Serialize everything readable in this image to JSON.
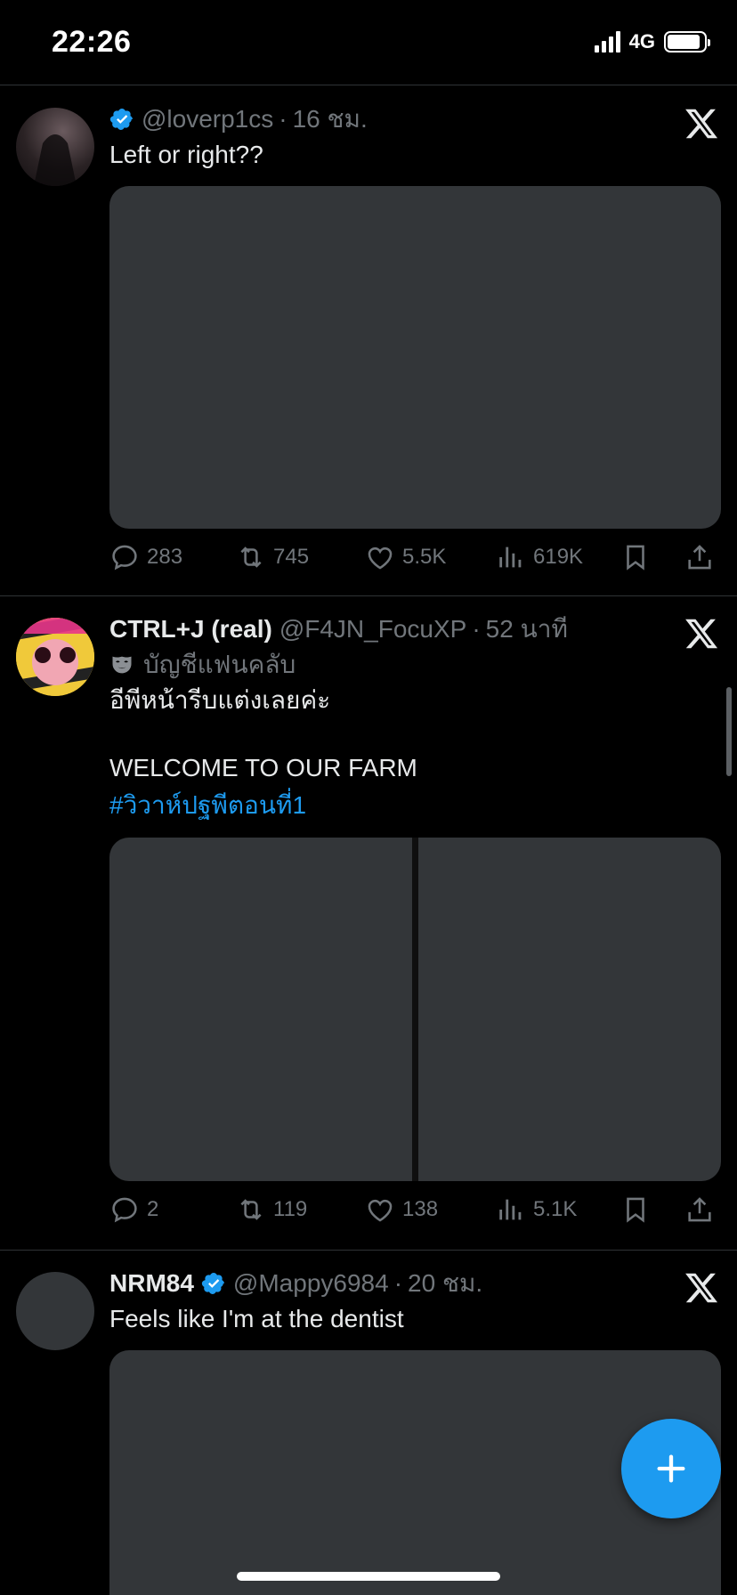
{
  "status_bar": {
    "time": "22:26",
    "network": "4G"
  },
  "posts": [
    {
      "display_name": "",
      "verified": true,
      "handle": "@loverp1cs",
      "time": "16 ชม.",
      "text": "Left or right??",
      "stats": {
        "replies": "283",
        "reposts": "745",
        "likes": "5.5K",
        "views": "619K"
      }
    },
    {
      "display_name": "CTRL+J (real)",
      "verified": false,
      "handle": "@F4JN_FocuXP",
      "time": "52 นาที",
      "fanclub_label": "บัญชีแฟนคลับ",
      "text": "อีพีหน้ารีบแต่งเลยค่ะ\n\nWELCOME TO OUR FARM",
      "hashtag": "#วิวาห์ปฐพีตอนที่1",
      "stats": {
        "replies": "2",
        "reposts": "119",
        "likes": "138",
        "views": "5.1K"
      }
    },
    {
      "display_name": "NRM84",
      "verified": true,
      "handle": "@Mappy6984",
      "time": "20 ชม.",
      "text": "Feels like I'm at the dentist"
    }
  ],
  "colors": {
    "accent": "#1d9bf0",
    "muted": "#71767b",
    "media": "#333639",
    "divider": "#2f3336"
  },
  "icons": [
    "reply-icon",
    "repost-icon",
    "like-icon",
    "views-icon",
    "bookmark-icon",
    "share-icon",
    "verified-icon",
    "x-logo-icon",
    "compose-icon"
  ]
}
